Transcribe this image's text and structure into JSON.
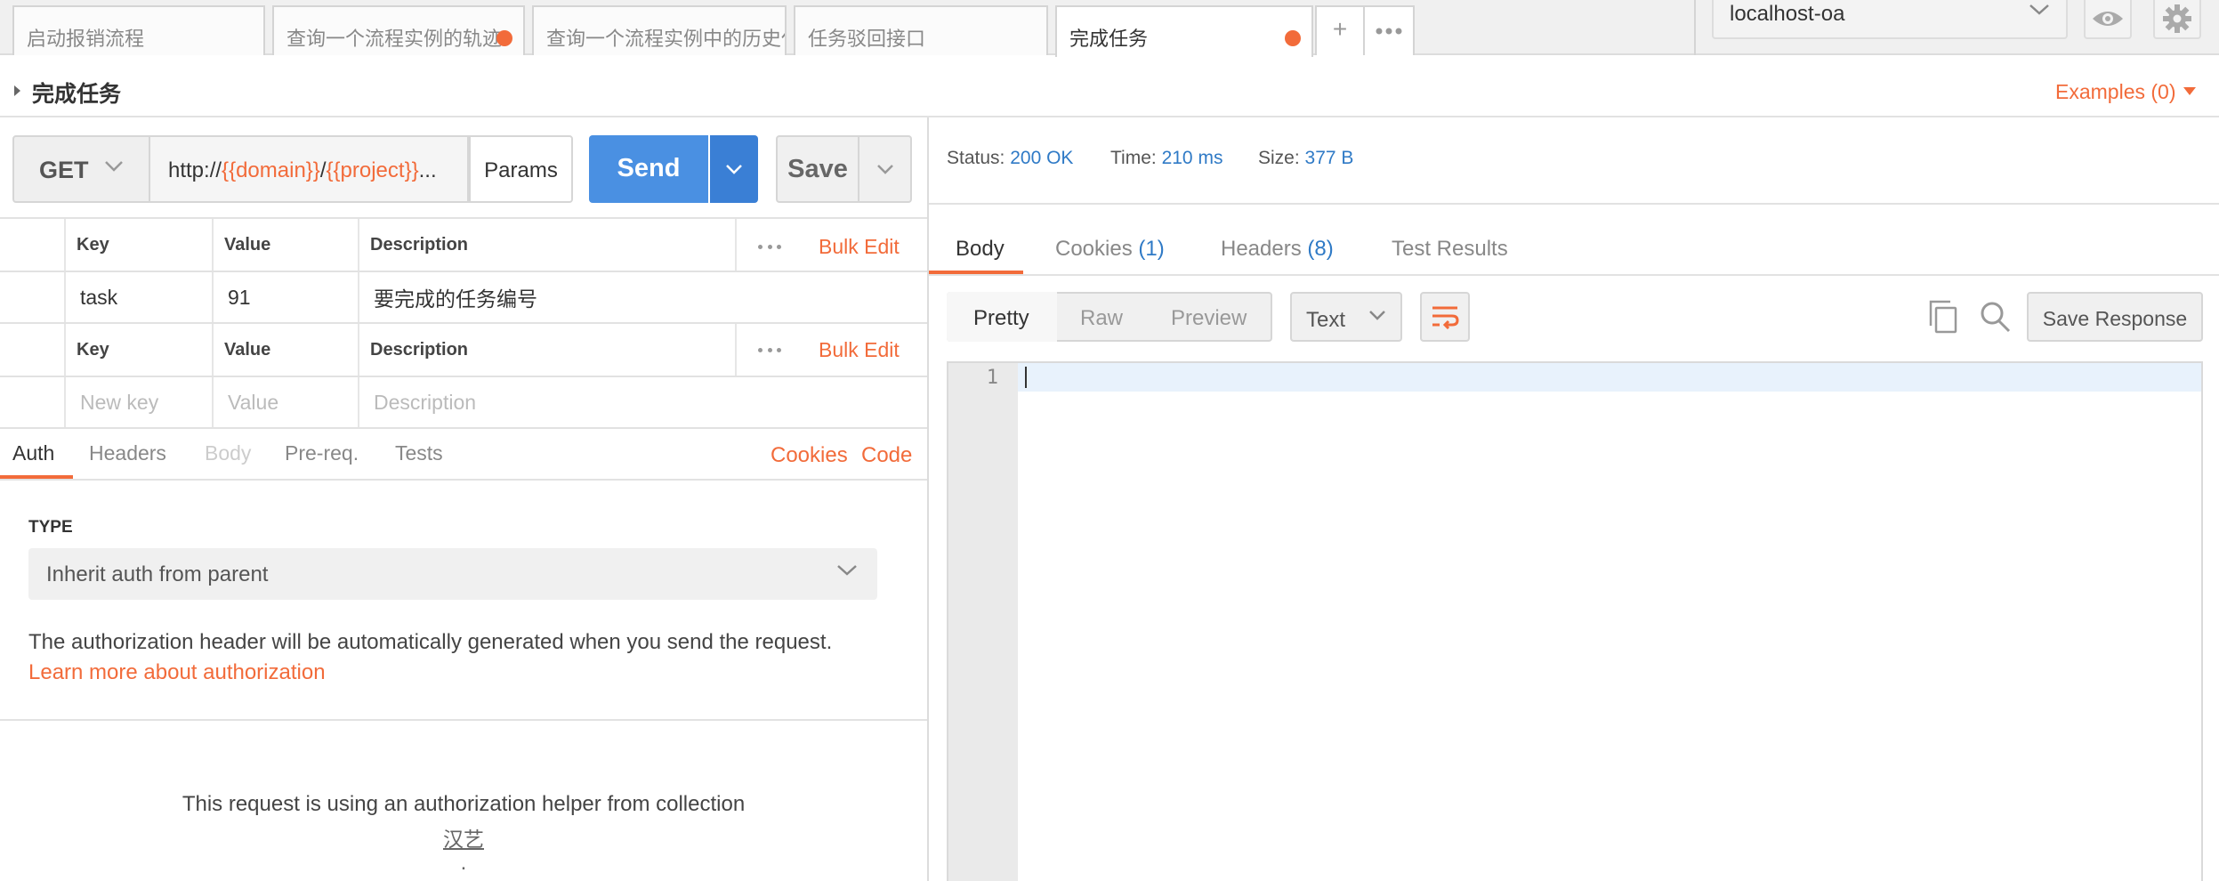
{
  "tabs": [
    {
      "label": "启动报销流程",
      "active": false,
      "unsaved": false
    },
    {
      "label": "查询一个流程实例的轨迹",
      "active": false,
      "unsaved": true
    },
    {
      "label": "查询一个流程实例中的历史任务",
      "active": false,
      "unsaved": false
    },
    {
      "label": "任务驳回接口",
      "active": false,
      "unsaved": false
    },
    {
      "label": "完成任务",
      "active": true,
      "unsaved": true
    }
  ],
  "tab_actions": {
    "add": "+"
  },
  "environment": {
    "selected": "localhost-oa"
  },
  "request": {
    "name": "完成任务",
    "examples_label": "Examples (0)",
    "method": "GET",
    "url_prefix": "http://",
    "url_var1": "{{domain}}",
    "url_sep": "/",
    "url_var2": "{{project}}",
    "url_more": "...",
    "params_label": "Params",
    "send_label": "Send",
    "save_label": "Save"
  },
  "params_table": {
    "headers": {
      "key": "Key",
      "value": "Value",
      "description": "Description"
    },
    "bulk_edit": "Bulk Edit",
    "rows": [
      {
        "key": "task",
        "value": "91",
        "description": "要完成的任务编号"
      }
    ],
    "placeholders": {
      "key": "New key",
      "value": "Value",
      "description": "Description"
    }
  },
  "request_tabs": {
    "items": [
      "Auth",
      "Headers",
      "Body",
      "Pre-req.",
      "Tests"
    ],
    "cookies_link": "Cookies",
    "code_link": "Code"
  },
  "auth": {
    "type_label": "TYPE",
    "selected": "Inherit auth from parent",
    "description": "The authorization header will be automatically generated when you send the request.",
    "learn_more": "Learn more about authorization",
    "helper_text": "This request is using an authorization helper from collection",
    "collection_name": "汉艺",
    "trailing": "."
  },
  "response": {
    "status_label": "Status:",
    "status_value": "200 OK",
    "time_label": "Time:",
    "time_value": "210 ms",
    "size_label": "Size:",
    "size_value": "377 B",
    "tabs": {
      "body": "Body",
      "cookies": "Cookies",
      "cookies_count": "(1)",
      "headers": "Headers",
      "headers_count": "(8)",
      "tests": "Test Results"
    },
    "views": [
      "Pretty",
      "Raw",
      "Preview"
    ],
    "format": "Text",
    "save_response": "Save Response",
    "line_number": "1"
  },
  "colors": {
    "accent": "#f26b3a",
    "send": "#4a90e2",
    "link_blue": "#2f7ac6"
  }
}
